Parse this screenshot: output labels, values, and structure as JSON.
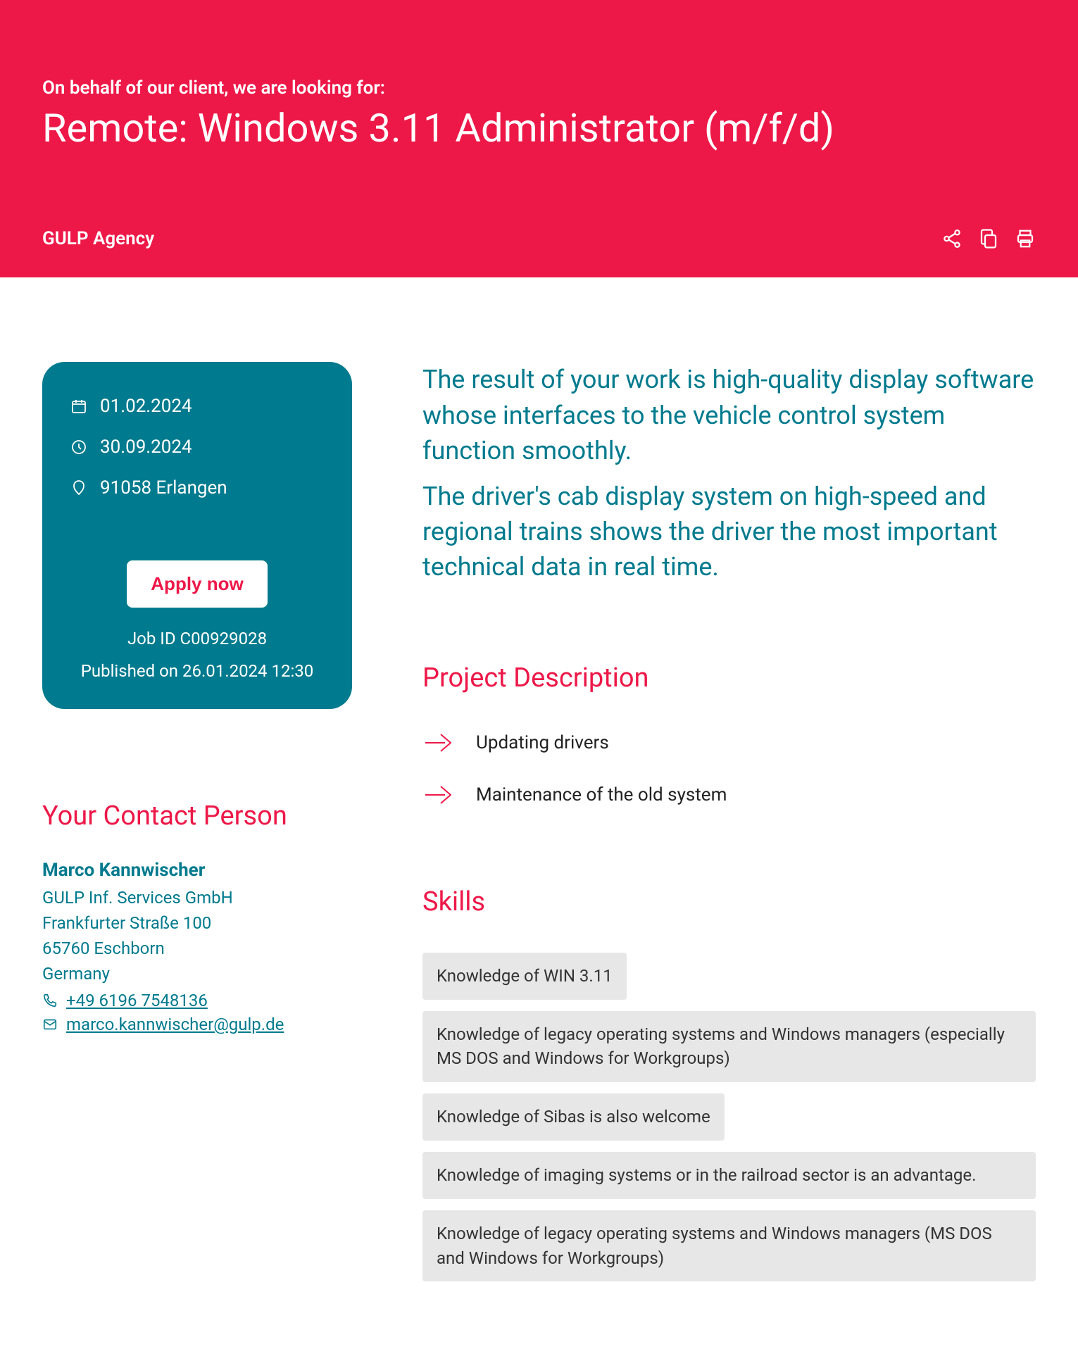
{
  "hero": {
    "subtitle": "On behalf of our client, we are looking for:",
    "title": "Remote: Windows 3.11 Administrator (m/f/d)",
    "agency": "GULP Agency"
  },
  "card": {
    "start_date": "01.02.2024",
    "end_date": "30.09.2024",
    "location": "91058 Erlangen",
    "apply_label": "Apply now",
    "job_id": "Job ID C00929028",
    "published": "Published on 26.01.2024 12:30"
  },
  "contact": {
    "heading": "Your Contact Person",
    "name": "Marco Kannwischer",
    "company": "GULP Inf. Services GmbH",
    "street": "Frankfurter Straße 100",
    "city": "65760 Eschborn",
    "country": "Germany",
    "phone": "+49 6196 7548136",
    "email": "marco.kannwischer@gulp.de"
  },
  "intro": {
    "p1": "The result of your work is high-quality display software whose interfaces to the vehicle control system function smoothly.",
    "p2": "The driver's cab display system on high-speed and regional trains shows the driver the most important technical data in real time."
  },
  "project": {
    "heading": "Project Description",
    "items": [
      "Updating drivers",
      "Maintenance of the old system"
    ]
  },
  "skills": {
    "heading": "Skills",
    "items": [
      "Knowledge of WIN 3.11",
      "Knowledge of legacy operating systems and Windows managers (especially MS DOS and Windows for Workgroups)",
      "Knowledge of Sibas is also welcome",
      "Knowledge of imaging systems or in the railroad sector is an advantage.",
      "Knowledge of legacy operating systems and Windows managers (MS DOS and Windows for Workgroups)"
    ]
  }
}
